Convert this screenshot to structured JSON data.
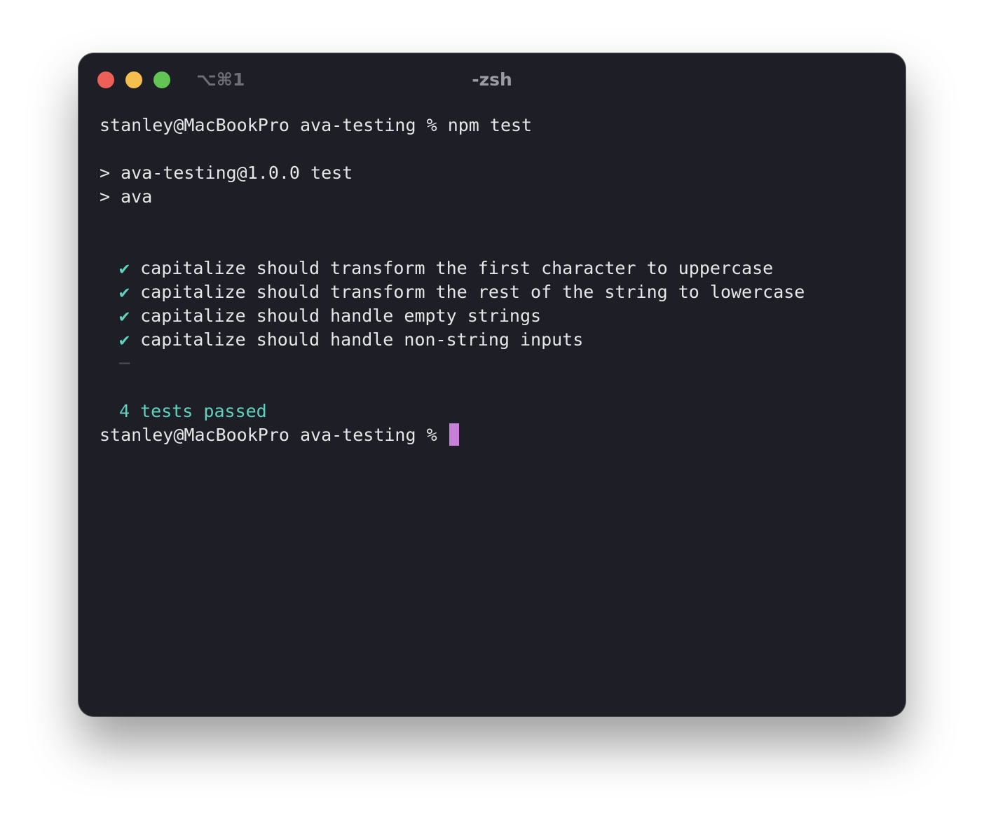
{
  "window": {
    "shortcut": "⌥⌘1",
    "title": "-zsh"
  },
  "terminal": {
    "command_prompt": "stanley@MacBookPro ava-testing % ",
    "command": "npm test",
    "script_lines": [
      "> ava-testing@1.0.0 test",
      "> ava"
    ],
    "check_glyph": "✔",
    "tests": [
      "capitalize should transform the first character to uppercase",
      "capitalize should transform the rest of the string to lowercase",
      "capitalize should handle empty strings",
      "capitalize should handle non-string inputs"
    ],
    "separator": "─",
    "summary": "4 tests passed",
    "final_prompt": "stanley@MacBookPro ava-testing % "
  },
  "colors": {
    "background": "#1e1f26",
    "text": "#e6e6e6",
    "success": "#5fd3c0",
    "cursor": "#c77fd9",
    "close": "#ed5f57",
    "minimize": "#f4bf4f",
    "zoom": "#61c454"
  }
}
